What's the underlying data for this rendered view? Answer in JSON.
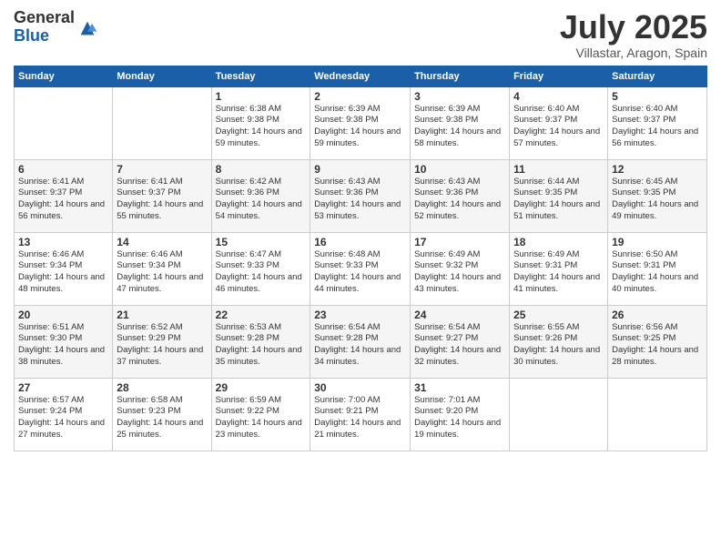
{
  "logo": {
    "general": "General",
    "blue": "Blue"
  },
  "header": {
    "month": "July 2025",
    "location": "Villastar, Aragon, Spain"
  },
  "weekdays": [
    "Sunday",
    "Monday",
    "Tuesday",
    "Wednesday",
    "Thursday",
    "Friday",
    "Saturday"
  ],
  "weeks": [
    [
      {
        "day": "",
        "info": ""
      },
      {
        "day": "",
        "info": ""
      },
      {
        "day": "1",
        "info": "Sunrise: 6:38 AM\nSunset: 9:38 PM\nDaylight: 14 hours and 59 minutes."
      },
      {
        "day": "2",
        "info": "Sunrise: 6:39 AM\nSunset: 9:38 PM\nDaylight: 14 hours and 59 minutes."
      },
      {
        "day": "3",
        "info": "Sunrise: 6:39 AM\nSunset: 9:38 PM\nDaylight: 14 hours and 58 minutes."
      },
      {
        "day": "4",
        "info": "Sunrise: 6:40 AM\nSunset: 9:37 PM\nDaylight: 14 hours and 57 minutes."
      },
      {
        "day": "5",
        "info": "Sunrise: 6:40 AM\nSunset: 9:37 PM\nDaylight: 14 hours and 56 minutes."
      }
    ],
    [
      {
        "day": "6",
        "info": "Sunrise: 6:41 AM\nSunset: 9:37 PM\nDaylight: 14 hours and 56 minutes."
      },
      {
        "day": "7",
        "info": "Sunrise: 6:41 AM\nSunset: 9:37 PM\nDaylight: 14 hours and 55 minutes."
      },
      {
        "day": "8",
        "info": "Sunrise: 6:42 AM\nSunset: 9:36 PM\nDaylight: 14 hours and 54 minutes."
      },
      {
        "day": "9",
        "info": "Sunrise: 6:43 AM\nSunset: 9:36 PM\nDaylight: 14 hours and 53 minutes."
      },
      {
        "day": "10",
        "info": "Sunrise: 6:43 AM\nSunset: 9:36 PM\nDaylight: 14 hours and 52 minutes."
      },
      {
        "day": "11",
        "info": "Sunrise: 6:44 AM\nSunset: 9:35 PM\nDaylight: 14 hours and 51 minutes."
      },
      {
        "day": "12",
        "info": "Sunrise: 6:45 AM\nSunset: 9:35 PM\nDaylight: 14 hours and 49 minutes."
      }
    ],
    [
      {
        "day": "13",
        "info": "Sunrise: 6:46 AM\nSunset: 9:34 PM\nDaylight: 14 hours and 48 minutes."
      },
      {
        "day": "14",
        "info": "Sunrise: 6:46 AM\nSunset: 9:34 PM\nDaylight: 14 hours and 47 minutes."
      },
      {
        "day": "15",
        "info": "Sunrise: 6:47 AM\nSunset: 9:33 PM\nDaylight: 14 hours and 46 minutes."
      },
      {
        "day": "16",
        "info": "Sunrise: 6:48 AM\nSunset: 9:33 PM\nDaylight: 14 hours and 44 minutes."
      },
      {
        "day": "17",
        "info": "Sunrise: 6:49 AM\nSunset: 9:32 PM\nDaylight: 14 hours and 43 minutes."
      },
      {
        "day": "18",
        "info": "Sunrise: 6:49 AM\nSunset: 9:31 PM\nDaylight: 14 hours and 41 minutes."
      },
      {
        "day": "19",
        "info": "Sunrise: 6:50 AM\nSunset: 9:31 PM\nDaylight: 14 hours and 40 minutes."
      }
    ],
    [
      {
        "day": "20",
        "info": "Sunrise: 6:51 AM\nSunset: 9:30 PM\nDaylight: 14 hours and 38 minutes."
      },
      {
        "day": "21",
        "info": "Sunrise: 6:52 AM\nSunset: 9:29 PM\nDaylight: 14 hours and 37 minutes."
      },
      {
        "day": "22",
        "info": "Sunrise: 6:53 AM\nSunset: 9:28 PM\nDaylight: 14 hours and 35 minutes."
      },
      {
        "day": "23",
        "info": "Sunrise: 6:54 AM\nSunset: 9:28 PM\nDaylight: 14 hours and 34 minutes."
      },
      {
        "day": "24",
        "info": "Sunrise: 6:54 AM\nSunset: 9:27 PM\nDaylight: 14 hours and 32 minutes."
      },
      {
        "day": "25",
        "info": "Sunrise: 6:55 AM\nSunset: 9:26 PM\nDaylight: 14 hours and 30 minutes."
      },
      {
        "day": "26",
        "info": "Sunrise: 6:56 AM\nSunset: 9:25 PM\nDaylight: 14 hours and 28 minutes."
      }
    ],
    [
      {
        "day": "27",
        "info": "Sunrise: 6:57 AM\nSunset: 9:24 PM\nDaylight: 14 hours and 27 minutes."
      },
      {
        "day": "28",
        "info": "Sunrise: 6:58 AM\nSunset: 9:23 PM\nDaylight: 14 hours and 25 minutes."
      },
      {
        "day": "29",
        "info": "Sunrise: 6:59 AM\nSunset: 9:22 PM\nDaylight: 14 hours and 23 minutes."
      },
      {
        "day": "30",
        "info": "Sunrise: 7:00 AM\nSunset: 9:21 PM\nDaylight: 14 hours and 21 minutes."
      },
      {
        "day": "31",
        "info": "Sunrise: 7:01 AM\nSunset: 9:20 PM\nDaylight: 14 hours and 19 minutes."
      },
      {
        "day": "",
        "info": ""
      },
      {
        "day": "",
        "info": ""
      }
    ]
  ]
}
